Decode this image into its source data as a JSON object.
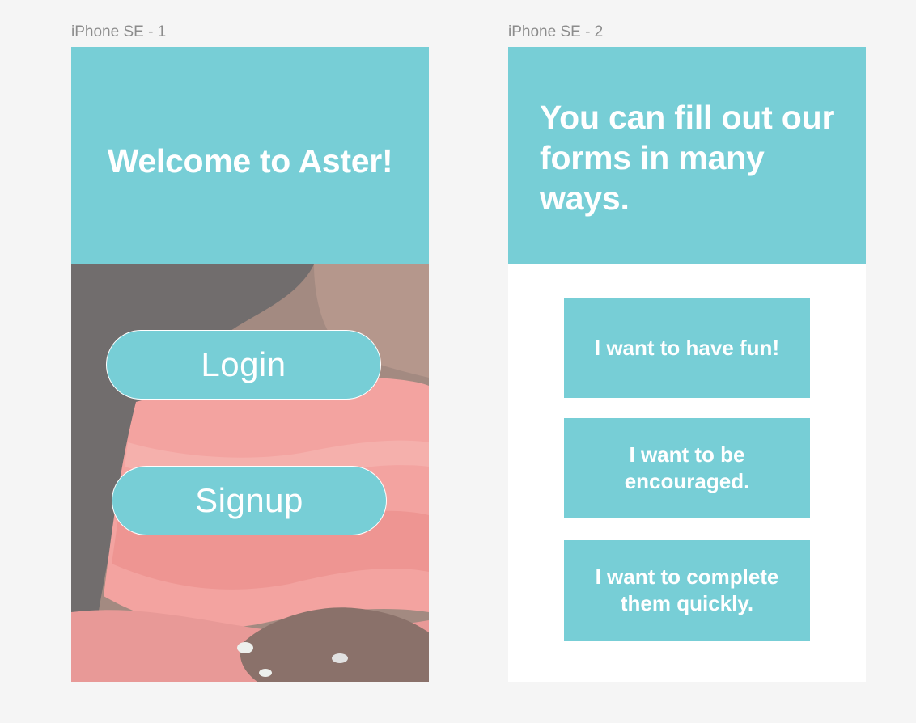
{
  "frames": [
    {
      "label": "iPhone SE - 1"
    },
    {
      "label": "iPhone SE - 2"
    }
  ],
  "screen1": {
    "title": "Welcome to Aster!",
    "login_label": "Login",
    "signup_label": "Signup"
  },
  "screen2": {
    "title": "You can fill out our forms in many ways.",
    "options": [
      {
        "label": "I want to have fun!"
      },
      {
        "label": "I want to be encouraged."
      },
      {
        "label": "I want to complete them quickly."
      }
    ]
  },
  "colors": {
    "accent": "#77ced6",
    "canvas": "#f5f5f5",
    "label_gray": "#8c8c8c",
    "photo_dress": "#f08a86",
    "photo_hair": "#3b3b3b"
  }
}
